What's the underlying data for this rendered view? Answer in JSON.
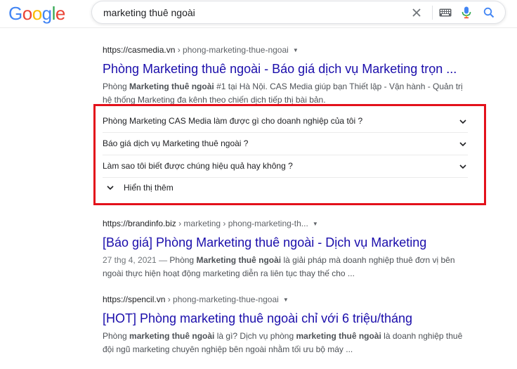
{
  "header": {
    "logo_letters": [
      {
        "ch": "G",
        "color": "#4285f4"
      },
      {
        "ch": "o",
        "color": "#ea4335"
      },
      {
        "ch": "o",
        "color": "#fbbc05"
      },
      {
        "ch": "g",
        "color": "#4285f4"
      },
      {
        "ch": "l",
        "color": "#34a853"
      },
      {
        "ch": "e",
        "color": "#ea4335"
      }
    ],
    "query": "marketing thuê ngoài"
  },
  "results": [
    {
      "domain": "https://casmedia.vn",
      "crumbs": " › phong-marketing-thue-ngoai",
      "title": "Phòng Marketing thuê ngoài - Báo giá dịch vụ Marketing trọn ...",
      "snippet_parts": [
        {
          "t": "Phòng ",
          "b": false
        },
        {
          "t": "Marketing thuê ngoài",
          "b": true
        },
        {
          "t": " #1 tại Hà Nội. CAS Media giúp bạn Thiết lập - Vận hành - Quản trị hệ thống Marketing đa kênh theo chiến dịch tiếp thị bài bản.",
          "b": false
        }
      ]
    },
    {
      "domain": "https://brandinfo.biz",
      "crumbs": " › marketing › phong-marketing-th...",
      "title": "[Báo giá] Phòng Marketing thuê ngoài - Dịch vụ Marketing",
      "date": "27 thg 4, 2021 — ",
      "snippet_parts": [
        {
          "t": "Phòng ",
          "b": false
        },
        {
          "t": "Marketing thuê ngoài",
          "b": true
        },
        {
          "t": " là giải pháp mà doanh nghiệp thuê đơn vị bên ngoài thực hiện hoạt động marketing diễn ra liên tục thay thế cho ...",
          "b": false
        }
      ]
    },
    {
      "domain": "https://spencil.vn",
      "crumbs": " › phong-marketing-thue-ngoai",
      "title": "[HOT] Phòng marketing thuê ngoài chỉ với 6 triệu/tháng",
      "snippet_parts": [
        {
          "t": "Phòng ",
          "b": false
        },
        {
          "t": "marketing thuê ngoài",
          "b": true
        },
        {
          "t": " là gì? Dịch vụ phòng ",
          "b": false
        },
        {
          "t": "marketing thuê ngoài",
          "b": true
        },
        {
          "t": " là doanh nghiệp thuê đội ngũ marketing chuyên nghiệp bên ngoài nhằm tối ưu bộ máy ...",
          "b": false
        }
      ]
    }
  ],
  "faq": {
    "questions": [
      "Phòng Marketing CAS Media làm được gì cho doanh nghiệp của tôi ?",
      "Báo giá dịch vụ Marketing thuê ngoài ?",
      "Làm sao tôi biết được chúng hiệu quả hay không ?"
    ],
    "show_more": "Hiển thị thêm",
    "highlight_color": "#e3111b"
  },
  "colors": {
    "link": "#1a0dab",
    "mic_blue": "#4285f4",
    "mic_red": "#ea4335"
  }
}
